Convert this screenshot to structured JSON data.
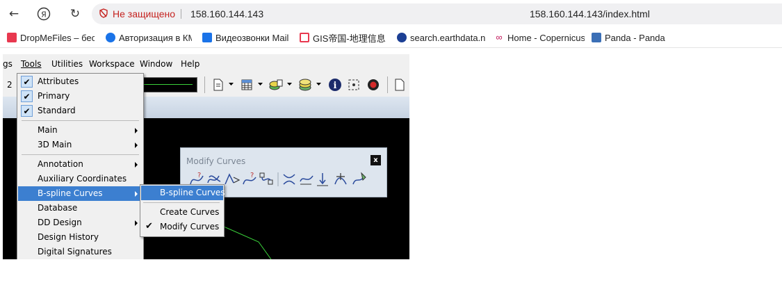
{
  "browser": {
    "security_warning": "Не защищено",
    "url_host": "158.160.144.143",
    "url_full": "158.160.144.143/index.html",
    "bookmarks": [
      {
        "label": "DropMeFiles – бес",
        "icon": "dropmefiles-icon",
        "color": "#e8384f"
      },
      {
        "label": "Авторизация в КМ",
        "icon": "auth-icon",
        "color": "#1a73e8"
      },
      {
        "label": "Видеозвонки Mail",
        "icon": "video-icon",
        "color": "#1a73e8"
      },
      {
        "label": "GIS帝国-地理信息",
        "icon": "gis-icon",
        "color": "#e8384f"
      },
      {
        "label": "search.earthdata.n",
        "icon": "nasa-icon",
        "color": "#1c3f94"
      },
      {
        "label": "Home - Copernicus",
        "icon": "copernicus-icon",
        "color": "#c2185b"
      },
      {
        "label": "Panda - Panda",
        "icon": "panda-icon",
        "color": "#3b6fb6"
      }
    ]
  },
  "menubar": {
    "items": [
      {
        "label": "gs"
      },
      {
        "label": "Tools"
      },
      {
        "label": "Utilities"
      },
      {
        "label": "Workspace"
      },
      {
        "label": "Window"
      },
      {
        "label": "Help"
      }
    ]
  },
  "toolbar": {
    "level_prefix": "2"
  },
  "tools_menu": {
    "items": [
      {
        "label": "Attributes",
        "checked": true
      },
      {
        "label": "Primary",
        "checked": true
      },
      {
        "label": "Standard",
        "checked": true
      },
      {
        "label": "Main",
        "submenu": true
      },
      {
        "label": "3D Main",
        "submenu": true
      },
      {
        "label": "Annotation",
        "submenu": true
      },
      {
        "label": "Auxiliary Coordinates"
      },
      {
        "label": "B-spline Curves",
        "submenu": true,
        "highlighted": true
      },
      {
        "label": "Database"
      },
      {
        "label": "DD Design",
        "submenu": true
      },
      {
        "label": "Design History"
      },
      {
        "label": "Digital Signatures"
      }
    ]
  },
  "bspline_submenu": {
    "items": [
      {
        "label": "B-spline Curves",
        "highlighted": true
      },
      {
        "label": "Create Curves"
      },
      {
        "label": "Modify Curves",
        "checked": true
      }
    ]
  },
  "modify_curves_panel": {
    "title": "Modify Curves",
    "close_label": "x"
  }
}
